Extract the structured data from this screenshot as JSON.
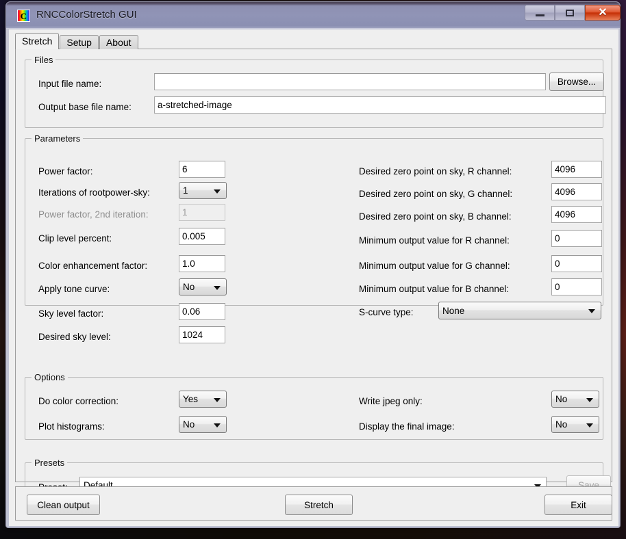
{
  "window": {
    "title": "RNCColorStretch GUI",
    "app_icon": "C",
    "controls": {
      "minimize": "minimize-icon",
      "maximize": "maximize-icon",
      "close": "close-icon",
      "close_glyph": "✕"
    }
  },
  "tabs": [
    {
      "label": "Stretch",
      "active": true
    },
    {
      "label": "Setup",
      "active": false
    },
    {
      "label": "About",
      "active": false
    }
  ],
  "files": {
    "legend": "Files",
    "input_label": "Input file name:",
    "input_value": "",
    "browse_label": "Browse...",
    "output_label": "Output base file name:",
    "output_value": "a-stretched-image"
  },
  "parameters": {
    "legend": "Parameters",
    "left": [
      {
        "label": "Power factor:",
        "value": "6",
        "type": "text",
        "disabled": false
      },
      {
        "label": "Iterations of rootpower-sky:",
        "value": "1",
        "type": "combo",
        "disabled": false
      },
      {
        "label": "Power factor, 2nd iteration:",
        "value": "1",
        "type": "text",
        "disabled": true
      },
      {
        "label": "Clip level percent:",
        "value": "0.005",
        "type": "text",
        "disabled": false
      },
      {
        "label": "Color enhancement factor:",
        "value": "1.0",
        "type": "text",
        "disabled": false
      },
      {
        "label": "Apply tone curve:",
        "value": "No",
        "type": "combo",
        "disabled": false
      },
      {
        "label": "Sky level factor:",
        "value": "0.06",
        "type": "text",
        "disabled": false
      },
      {
        "label": "Desired sky level:",
        "value": "1024",
        "type": "text",
        "disabled": false
      }
    ],
    "right": [
      {
        "label": "Desired zero point on sky, R channel:",
        "value": "4096",
        "type": "text"
      },
      {
        "label": "Desired zero point on sky, G channel:",
        "value": "4096",
        "type": "text"
      },
      {
        "label": "Desired zero point on sky, B channel:",
        "value": "4096",
        "type": "text"
      },
      {
        "label": "Minimum output value for R channel:",
        "value": "0",
        "type": "text"
      },
      {
        "label": "Minimum output value for G channel:",
        "value": "0",
        "type": "text"
      },
      {
        "label": "Minimum output value for B channel:",
        "value": "0",
        "type": "text"
      }
    ],
    "scurve": {
      "label": "S-curve type:",
      "value": "None"
    }
  },
  "options": {
    "legend": "Options",
    "left": [
      {
        "label": "Do color correction:",
        "value": "Yes"
      },
      {
        "label": "Plot histograms:",
        "value": "No"
      }
    ],
    "right": [
      {
        "label": "Write jpeg only:",
        "value": "No"
      },
      {
        "label": "Display the final image:",
        "value": "No"
      }
    ]
  },
  "presets": {
    "legend": "Presets",
    "label": "Preset:",
    "value": "Default",
    "save_label": "Save"
  },
  "actions": {
    "clean_label": "Clean output",
    "stretch_label": "Stretch",
    "exit_label": "Exit"
  },
  "colors": {
    "titlebar": "#8f93b5",
    "close_button": "#c52f06",
    "client_background": "#efefef",
    "field_background": "#ffffff"
  }
}
